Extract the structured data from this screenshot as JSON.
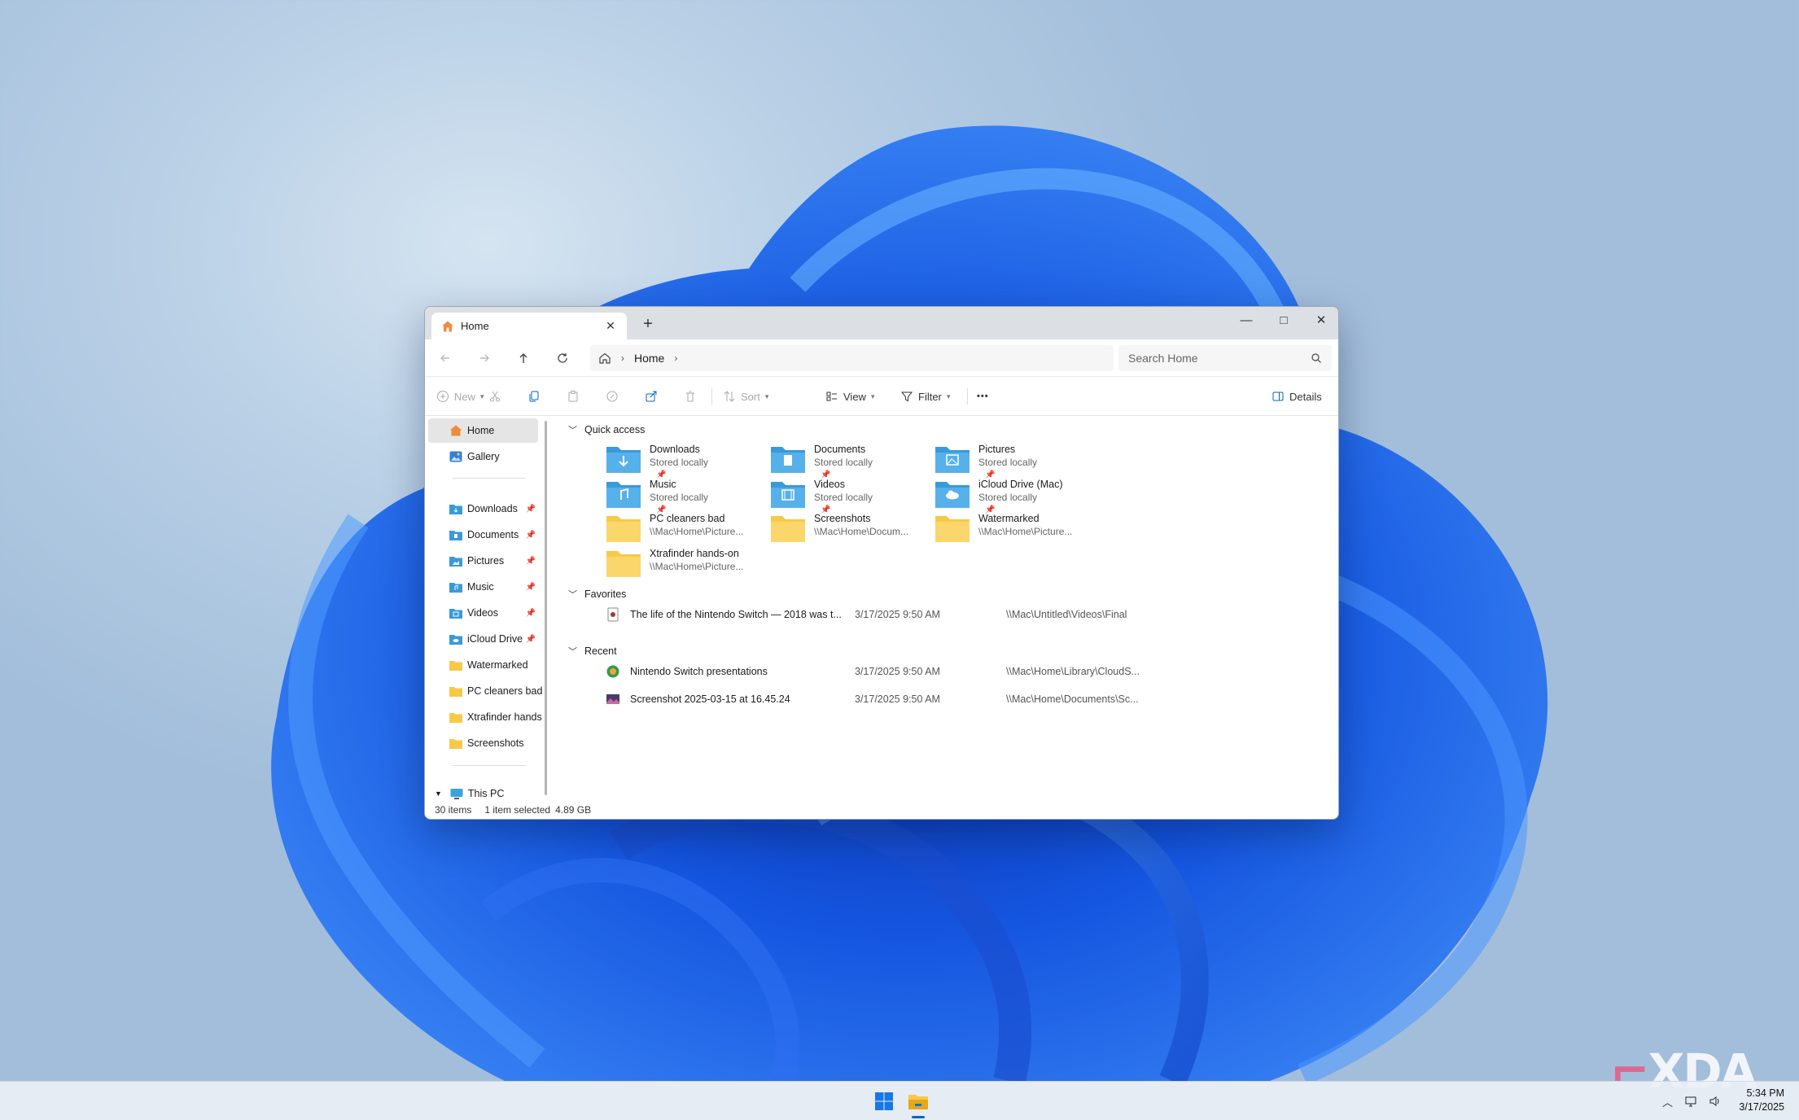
{
  "window": {
    "tab_title": "Home",
    "new_tab": "+",
    "minimize": "—",
    "maximize": "□",
    "close": "✕"
  },
  "navigation": {
    "breadcrumb": [
      "Home"
    ],
    "search_placeholder": "Search Home"
  },
  "toolbar": {
    "new": "New",
    "sort": "Sort",
    "view": "View",
    "filter": "Filter",
    "more": "•••",
    "details": "Details"
  },
  "sidebar": {
    "top": [
      {
        "label": "Home",
        "icon": "home-icon",
        "selected": true
      },
      {
        "label": "Gallery",
        "icon": "gallery-icon"
      }
    ],
    "pinned": [
      {
        "label": "Downloads",
        "icon": "downloads-folder-icon",
        "pinned": true
      },
      {
        "label": "Documents",
        "icon": "documents-folder-icon",
        "pinned": true
      },
      {
        "label": "Pictures",
        "icon": "pictures-folder-icon",
        "pinned": true
      },
      {
        "label": "Music",
        "icon": "music-folder-icon",
        "pinned": true
      },
      {
        "label": "Videos",
        "icon": "videos-folder-icon",
        "pinned": true
      },
      {
        "label": "iCloud Drive",
        "icon": "icloud-folder-icon",
        "pinned": true
      },
      {
        "label": "Watermarked",
        "icon": "folder-icon"
      },
      {
        "label": "PC cleaners bad",
        "icon": "folder-icon"
      },
      {
        "label": "Xtrafinder hands",
        "icon": "folder-icon"
      },
      {
        "label": "Screenshots",
        "icon": "folder-icon"
      }
    ],
    "this_pc": "This PC"
  },
  "quick_access": {
    "heading": "Quick access",
    "items": [
      {
        "name": "Downloads",
        "sub": "Stored locally",
        "pinned": true,
        "icon": "downloads-folder-icon"
      },
      {
        "name": "Documents",
        "sub": "Stored locally",
        "pinned": true,
        "icon": "documents-folder-icon"
      },
      {
        "name": "Pictures",
        "sub": "Stored locally",
        "pinned": true,
        "icon": "pictures-folder-icon"
      },
      {
        "name": "Music",
        "sub": "Stored locally",
        "pinned": true,
        "icon": "music-folder-icon"
      },
      {
        "name": "Videos",
        "sub": "Stored locally",
        "pinned": true,
        "icon": "videos-folder-icon"
      },
      {
        "name": "iCloud Drive (Mac)",
        "sub": "Stored locally",
        "pinned": true,
        "icon": "icloud-folder-icon"
      },
      {
        "name": "PC cleaners bad",
        "sub": "\\\\Mac\\Home\\Picture...",
        "pinned": false,
        "icon": "folder-icon"
      },
      {
        "name": "Screenshots",
        "sub": "\\\\Mac\\Home\\Docum...",
        "pinned": false,
        "icon": "folder-icon"
      },
      {
        "name": "Watermarked",
        "sub": "\\\\Mac\\Home\\Picture...",
        "pinned": false,
        "icon": "folder-icon"
      },
      {
        "name": "Xtrafinder hands-on",
        "sub": "\\\\Mac\\Home\\Picture...",
        "pinned": false,
        "icon": "folder-icon"
      }
    ]
  },
  "favorites": {
    "heading": "Favorites",
    "items": [
      {
        "name": "The life of the Nintendo Switch — 2018 was t...",
        "date": "3/17/2025 9:50 AM",
        "location": "\\\\Mac\\Untitled\\Videos\\Final"
      }
    ]
  },
  "recent": {
    "heading": "Recent",
    "items": [
      {
        "name": "Nintendo Switch presentations",
        "date": "3/17/2025 9:50 AM",
        "location": "\\\\Mac\\Home\\Library\\CloudS..."
      },
      {
        "name": "Screenshot 2025-03-15 at 16.45.24",
        "date": "3/17/2025 9:50 AM",
        "location": "\\\\Mac\\Home\\Documents\\Sc..."
      }
    ]
  },
  "status": {
    "items": "30 items",
    "selected": "1 item selected",
    "size": "4.89 GB"
  },
  "taskbar": {
    "time": "5:34 PM",
    "date": "3/17/2025"
  },
  "watermark": "XDA",
  "colors": {
    "accent": "#0067c0",
    "folder_yellow": "#f7c948",
    "folder_blue": "#3a9ad9",
    "wallpaper_blue": "#1e5fe0"
  }
}
